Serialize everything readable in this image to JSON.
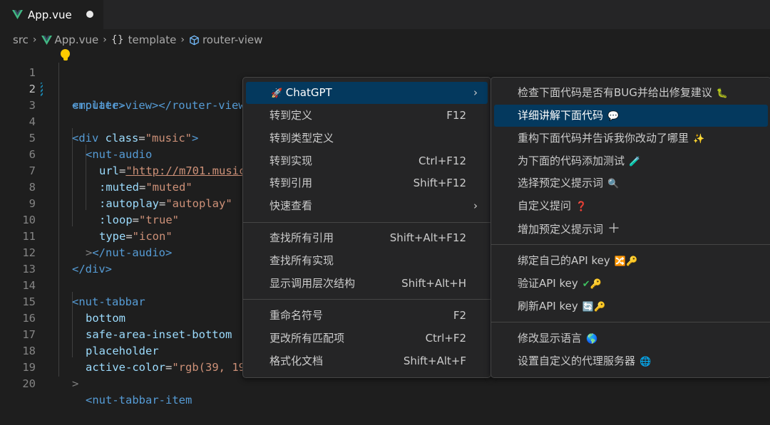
{
  "tab": {
    "filename": "App.vue"
  },
  "breadcrumb": {
    "items": [
      "src",
      "App.vue",
      "template",
      "router-view"
    ]
  },
  "editor": {
    "lines": [
      {
        "n": "1"
      },
      {
        "n": "2"
      },
      {
        "n": "3"
      },
      {
        "n": "4"
      },
      {
        "n": "5"
      },
      {
        "n": "6"
      },
      {
        "n": "7"
      },
      {
        "n": "8"
      },
      {
        "n": "9"
      },
      {
        "n": "10"
      },
      {
        "n": "11"
      },
      {
        "n": "12"
      },
      {
        "n": "13"
      },
      {
        "n": "14"
      },
      {
        "n": "15"
      },
      {
        "n": "16"
      },
      {
        "n": "17"
      },
      {
        "n": "18"
      },
      {
        "n": "19"
      },
      {
        "n": "20"
      }
    ],
    "code": {
      "l1": "emplate>",
      "l2a": "<router-view></router-view>",
      "l4tag": "<div ",
      "l4attr": "class",
      "l4eq": "=",
      "l4str": "\"music\"",
      "l4end": ">",
      "l5": "<nut-audio",
      "l6attr": "url",
      "l6eq": "=",
      "l6str": "\"http://m701.music",
      "l7attr": ":muted",
      "l7eq": "=",
      "l7str": "\"muted\"",
      "l8attr": ":autoplay",
      "l8eq": "=",
      "l8str": "\"autoplay\"",
      "l9attr": ":loop",
      "l9eq": "=",
      "l9str": "\"true\"",
      "l10attr": "type",
      "l10eq": "=",
      "l10str": "\"icon\"",
      "l11a": ">",
      "l11b": "</nut-audio>",
      "l12": "</div>",
      "l14": "<nut-tabbar",
      "l15": "bottom",
      "l16": "safe-area-inset-bottom",
      "l17": "placeholder",
      "l18attr": "active-color",
      "l18eq": "=",
      "l18str": "\"rgb(39, 19",
      "l19": ">",
      "l20": "<nut-tabbar-item"
    }
  },
  "context_menu": {
    "items": [
      {
        "label": "ChatGPT",
        "shortcut": ""
      },
      {
        "label": "转到定义",
        "shortcut": "F12"
      },
      {
        "label": "转到类型定义",
        "shortcut": ""
      },
      {
        "label": "转到实现",
        "shortcut": "Ctrl+F12"
      },
      {
        "label": "转到引用",
        "shortcut": "Shift+F12"
      },
      {
        "label": "快速查看",
        "shortcut": ""
      },
      {
        "label": "查找所有引用",
        "shortcut": "Shift+Alt+F12"
      },
      {
        "label": "查找所有实现",
        "shortcut": ""
      },
      {
        "label": "显示调用层次结构",
        "shortcut": "Shift+Alt+H"
      },
      {
        "label": "重命名符号",
        "shortcut": "F2"
      },
      {
        "label": "更改所有匹配项",
        "shortcut": "Ctrl+F2"
      },
      {
        "label": "格式化文档",
        "shortcut": "Shift+Alt+F"
      }
    ]
  },
  "chatgpt_submenu": {
    "items": [
      {
        "label": "检查下面代码是否有BUG并给出修复建议",
        "icon": "bug-icon"
      },
      {
        "label": "详细讲解下面代码",
        "icon": "speech-bubble-icon"
      },
      {
        "label": "重构下面代码并告诉我你改动了哪里",
        "icon": "magic-wand-icon"
      },
      {
        "label": "为下面的代码添加测试",
        "icon": "test-tube-icon"
      },
      {
        "label": "选择预定义提示词",
        "icon": "magnifier-icon"
      },
      {
        "label": "自定义提问",
        "icon": "question-mark-icon"
      },
      {
        "label": "增加预定义提示词",
        "icon": "plus-icon"
      },
      {
        "label": "绑定自己的API key",
        "icon": "shuffle-key-icon"
      },
      {
        "label": "验证API key",
        "icon": "check-key-icon"
      },
      {
        "label": "刷新API key",
        "icon": "refresh-key-icon"
      },
      {
        "label": "修改显示语言",
        "icon": "globe-icon"
      },
      {
        "label": "设置自定义的代理服务器",
        "icon": "globe-mesh-icon"
      }
    ]
  },
  "colors": {
    "accent_selection": "#04395e",
    "vue_green": "#41b883",
    "tag_blue": "#569cd6",
    "string_orange": "#ce9178",
    "attr_cyan": "#9cdcfe"
  }
}
